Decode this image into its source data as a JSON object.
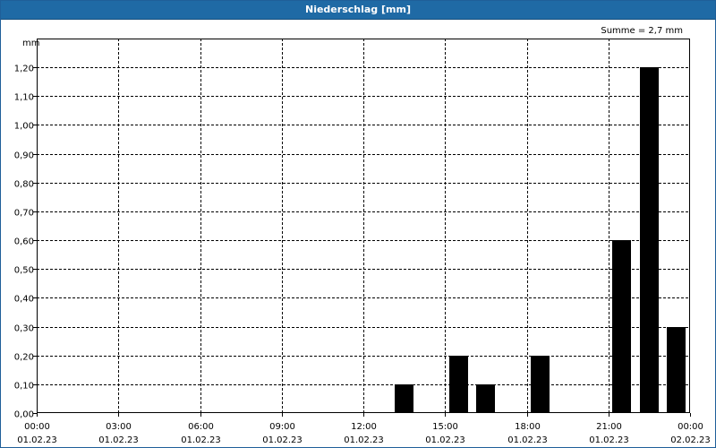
{
  "window": {
    "title": "Niederschlag [mm]"
  },
  "chart_data": {
    "type": "bar",
    "title": "Niederschlag [mm]",
    "ylabel": "mm",
    "annotation": "Summe = 2,7 mm",
    "ylim": [
      0,
      1.3
    ],
    "yticks": [
      "0,00",
      "0,10",
      "0,20",
      "0,30",
      "0,40",
      "0,50",
      "0,60",
      "0,70",
      "0,80",
      "0,90",
      "1,00",
      "1,10",
      "1,20"
    ],
    "x_range_hours": [
      0,
      24
    ],
    "xticks": [
      {
        "time": "00:00",
        "date": "01.02.23"
      },
      {
        "time": "03:00",
        "date": "01.02.23"
      },
      {
        "time": "06:00",
        "date": "01.02.23"
      },
      {
        "time": "09:00",
        "date": "01.02.23"
      },
      {
        "time": "12:00",
        "date": "01.02.23"
      },
      {
        "time": "15:00",
        "date": "01.02.23"
      },
      {
        "time": "18:00",
        "date": "01.02.23"
      },
      {
        "time": "21:00",
        "date": "01.02.23"
      },
      {
        "time": "00:00",
        "date": "02.02.23"
      }
    ],
    "series": [
      {
        "values": [
          {
            "hour": 13,
            "value": 0.1
          },
          {
            "hour": 15,
            "value": 0.2
          },
          {
            "hour": 16,
            "value": 0.1
          },
          {
            "hour": 18,
            "value": 0.2
          },
          {
            "hour": 21,
            "value": 0.6
          },
          {
            "hour": 22,
            "value": 1.2
          },
          {
            "hour": 23,
            "value": 0.3
          }
        ]
      }
    ],
    "bar_color": "#000000",
    "grid": true
  }
}
